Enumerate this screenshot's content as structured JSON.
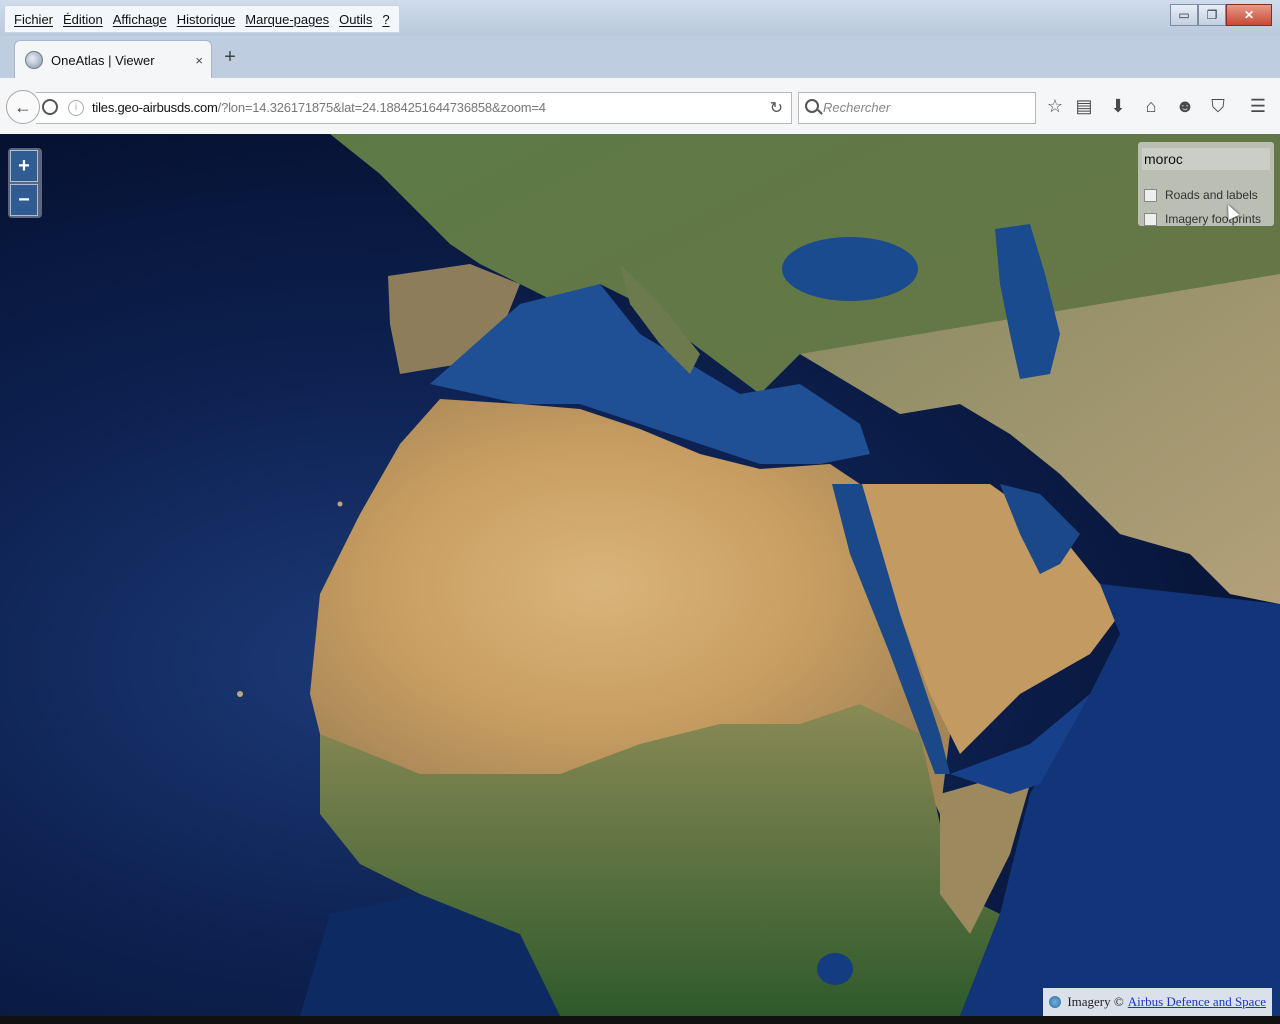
{
  "menu": {
    "items": [
      "Fichier",
      "Édition",
      "Affichage",
      "Historique",
      "Marque-pages",
      "Outils",
      "?"
    ]
  },
  "window_controls": {
    "minimize": "▭",
    "maximize": "❐",
    "close": "✕"
  },
  "tab": {
    "title": "OneAtlas | Viewer",
    "close": "×",
    "new_tab": "+"
  },
  "nav": {
    "url_host": "tiles.geo-airbusds.com",
    "url_rest": "/?lon=14.326171875&lat=24.1884251644736858&zoom=4",
    "search_placeholder": "Rechercher",
    "icons": [
      "back-icon",
      "site-identity-icon",
      "info-icon",
      "reload-icon",
      "bookmark-star-icon",
      "reading-list-icon",
      "download-icon",
      "home-icon",
      "chat-icon",
      "pocket-icon",
      "menu-icon"
    ]
  },
  "map": {
    "zoom_in": "+",
    "zoom_out": "−",
    "layer_panel": {
      "search_value": "moroc",
      "layers": [
        {
          "label": "Roads and labels",
          "checked": false
        },
        {
          "label": "Imagery footprints",
          "checked": false
        }
      ]
    },
    "attribution": {
      "prefix": "Imagery ©",
      "link_text": "Airbus Defence and Space"
    }
  }
}
